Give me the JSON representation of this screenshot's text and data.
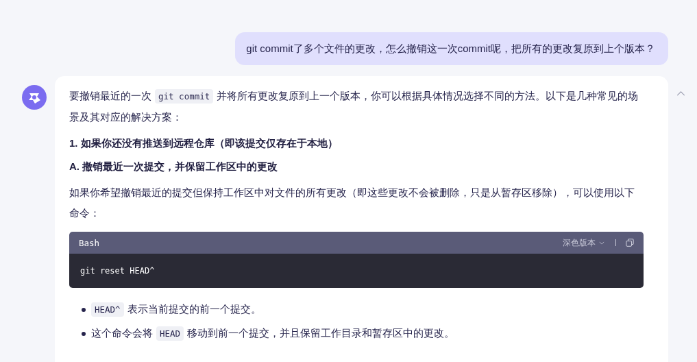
{
  "user_message": {
    "text": "git commit了多个文件的更改，怎么撤销这一次commit呢，把所有的更改复原到上个版本？"
  },
  "answer": {
    "blocks": [
      {
        "kind": "paragraph",
        "parts": [
          {
            "kind": "text",
            "text": "要撤销最近的一次"
          },
          {
            "kind": "code",
            "text": "git commit"
          },
          {
            "kind": "text",
            "text": "并将所有更改复原到上一个版本，你可以根据具体情况选择不同的方法。以下是几种常见的场景及其对应的解决方案："
          }
        ]
      },
      {
        "kind": "heading",
        "text": "1. 如果你还没有推送到远程仓库（即该提交仅存在于本地）"
      },
      {
        "kind": "heading",
        "text": "A. 撤销最近一次提交，并保留工作区中的更改"
      },
      {
        "kind": "paragraph",
        "parts": [
          {
            "kind": "text",
            "text": "如果你希望撤销最近的提交但保持工作区中对文件的所有更改（即这些更改不会被删除，只是从暂存区移除），可以使用以下命令："
          }
        ]
      },
      {
        "kind": "codeblock",
        "language": "Bash",
        "theme": "深色版本",
        "code": "git reset HEAD^"
      },
      {
        "kind": "bullet",
        "parts": [
          {
            "kind": "code",
            "text": "HEAD^"
          },
          {
            "kind": "text",
            "text": "表示当前提交的前一个提交。"
          }
        ]
      },
      {
        "kind": "bullet",
        "parts": [
          {
            "kind": "text",
            "text": "这个命令会将"
          },
          {
            "kind": "code",
            "text": "HEAD"
          },
          {
            "kind": "text",
            "text": "移动到前一个提交，并且保留工作目录和暂存区中的更改。"
          }
        ]
      }
    ]
  }
}
